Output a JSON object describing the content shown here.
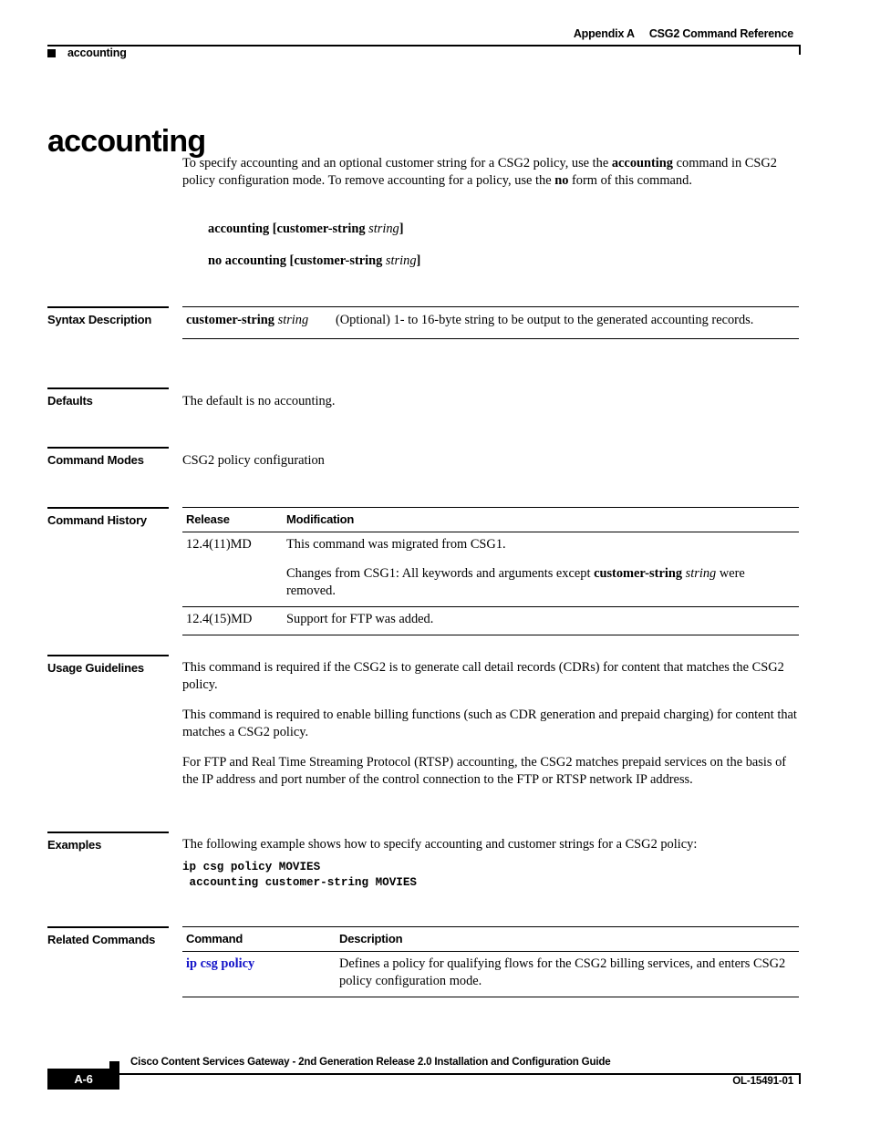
{
  "header": {
    "appendix": "Appendix A",
    "section_title": "CSG2 Command Reference",
    "running_head": "accounting"
  },
  "title": "accounting",
  "intro": {
    "part1": "To specify accounting and an optional customer string for a CSG2 policy, use the ",
    "bold1": "accounting",
    "part2": " command in CSG2 policy configuration mode. To remove accounting for a policy, use the ",
    "bold2": "no",
    "part3": " form of this command."
  },
  "syntax": {
    "line1_bold": "accounting [customer-string ",
    "line1_italic": "string",
    "line1_end": "]",
    "line2_bold": "no accounting [customer-string ",
    "line2_italic": "string",
    "line2_end": "]"
  },
  "sections": {
    "syntax_description": {
      "label": "Syntax Description",
      "rows": [
        {
          "term_bold": "customer-string",
          "term_italic": "string",
          "description": "(Optional) 1- to 16-byte string to be output to the generated accounting records."
        }
      ]
    },
    "defaults": {
      "label": "Defaults",
      "text": "The default is no accounting."
    },
    "command_modes": {
      "label": "Command Modes",
      "text": "CSG2 policy configuration"
    },
    "command_history": {
      "label": "Command History",
      "columns": [
        "Release",
        "Modification"
      ],
      "rows": [
        {
          "release": "12.4(11)MD",
          "mod_p1": "This command was migrated from CSG1.",
          "mod_p2_pre": "Changes from CSG1: All keywords and arguments except ",
          "mod_p2_bold": "customer-string",
          "mod_p2_italic": "string",
          "mod_p2_post": " were removed."
        },
        {
          "release": "12.4(15)MD",
          "mod_p1": "Support for FTP was added."
        }
      ]
    },
    "usage_guidelines": {
      "label": "Usage Guidelines",
      "paragraphs": [
        "This command is required if the CSG2 is to generate call detail records (CDRs) for content that matches the CSG2 policy.",
        "This command is required to enable billing functions (such as CDR generation and prepaid charging) for content that matches a CSG2 policy.",
        "For FTP and Real Time Streaming Protocol (RTSP) accounting, the CSG2 matches prepaid services on the basis of the IP address and port number of the control connection to the FTP or RTSP network IP address."
      ]
    },
    "examples": {
      "label": "Examples",
      "intro": "The following example shows how to specify accounting and customer strings for a CSG2 policy:",
      "code": "ip csg policy MOVIES\n accounting customer-string MOVIES"
    },
    "related_commands": {
      "label": "Related Commands",
      "columns": [
        "Command",
        "Description"
      ],
      "rows": [
        {
          "command": "ip csg policy",
          "description": "Defines a policy for qualifying flows for the CSG2 billing services, and enters CSG2 policy configuration mode."
        }
      ]
    }
  },
  "footer": {
    "title": "Cisco Content Services Gateway - 2nd Generation Release 2.0 Installation and Configuration Guide",
    "page_number": "A-6",
    "doc_id": "OL-15491-01"
  },
  "colors": {
    "link": "#1414c8",
    "text": "#000000",
    "background": "#ffffff"
  }
}
